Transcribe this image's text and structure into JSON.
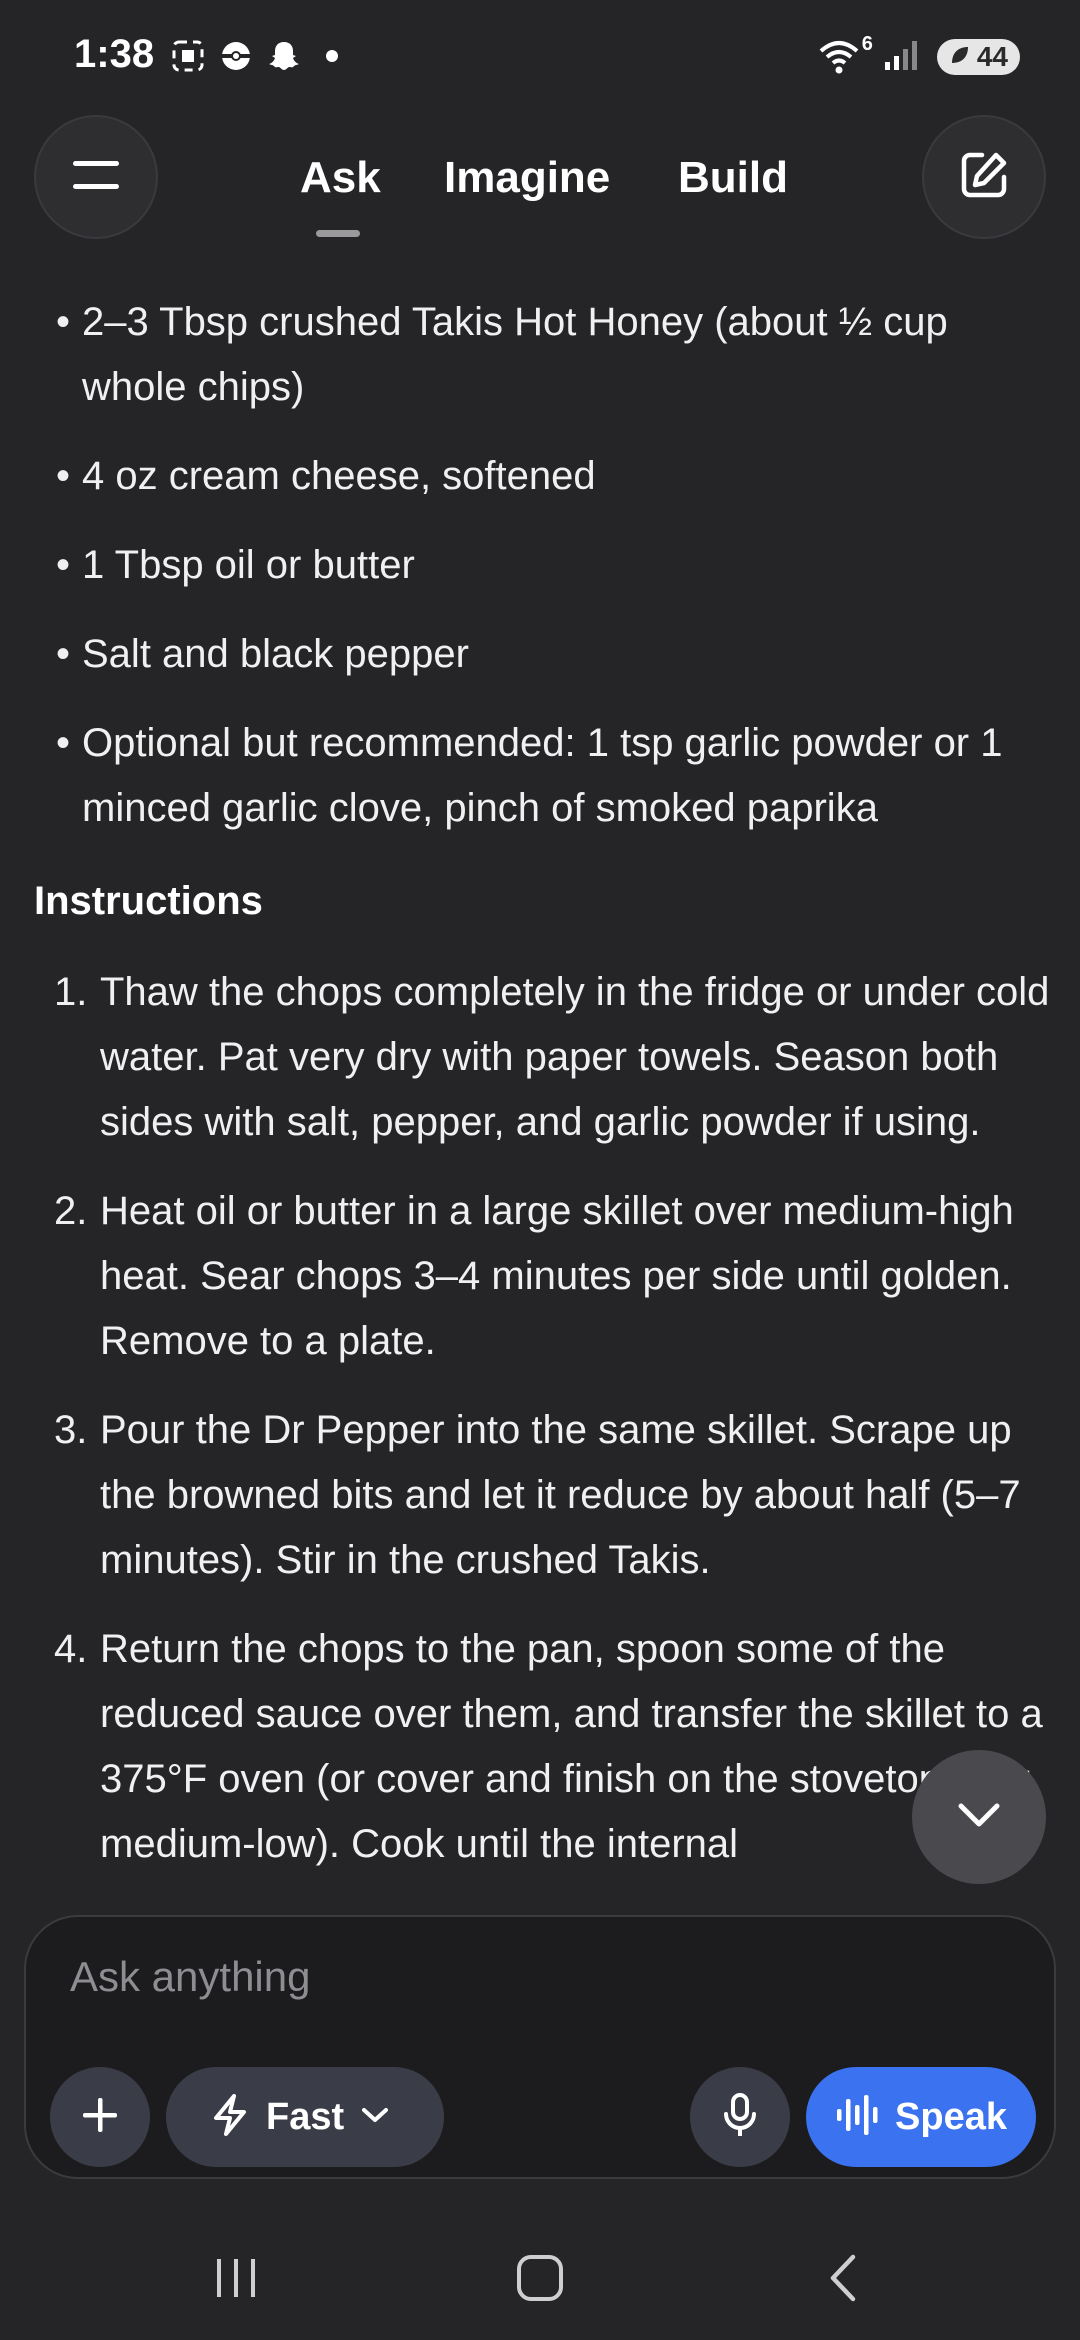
{
  "status_bar": {
    "time": "1:38",
    "left_icons": [
      "screenshot-icon",
      "pokeball-icon",
      "snapchat-icon",
      "dot-icon"
    ],
    "wifi_label": "6",
    "battery": "44"
  },
  "header": {
    "tabs": [
      {
        "label": "Ask",
        "active": true
      },
      {
        "label": "Imagine",
        "active": false
      },
      {
        "label": "Build",
        "active": false
      }
    ]
  },
  "content": {
    "bullets": [
      "2–3 Tbsp crushed Takis Hot Honey (about ½ cup whole chips)",
      "4 oz cream cheese, softened",
      "1 Tbsp oil or butter",
      "Salt and black pepper",
      "Optional but recommended: 1 tsp garlic powder or 1 minced garlic clove, pinch of smoked paprika"
    ],
    "instructions_title": "Instructions",
    "steps": [
      {
        "num": "1.",
        "text": "Thaw the chops completely in the fridge or under cold water. Pat very dry with paper towels. Season both sides with salt, pepper, and garlic powder if using."
      },
      {
        "num": "2.",
        "text": "Heat oil or butter in a large skillet over medium-high heat. Sear chops 3–4 minutes per side until golden. Remove to a plate."
      },
      {
        "num": "3.",
        "text": "Pour the Dr Pepper into the same skillet. Scrape up the browned bits and let it reduce by about half (5–7 minutes). Stir in the crushed Takis."
      },
      {
        "num": "4.",
        "text": "Return the chops to the pan, spoon some of the reduced sauce over them, and transfer the skillet to a 375°F oven (or cover and finish on the stovetop over medium-low). Cook until the internal"
      }
    ]
  },
  "composer": {
    "placeholder": "Ask anything",
    "model_label": "Fast",
    "speak_label": "Speak"
  },
  "colors": {
    "background": "#252528",
    "accent": "#3b72f0"
  }
}
